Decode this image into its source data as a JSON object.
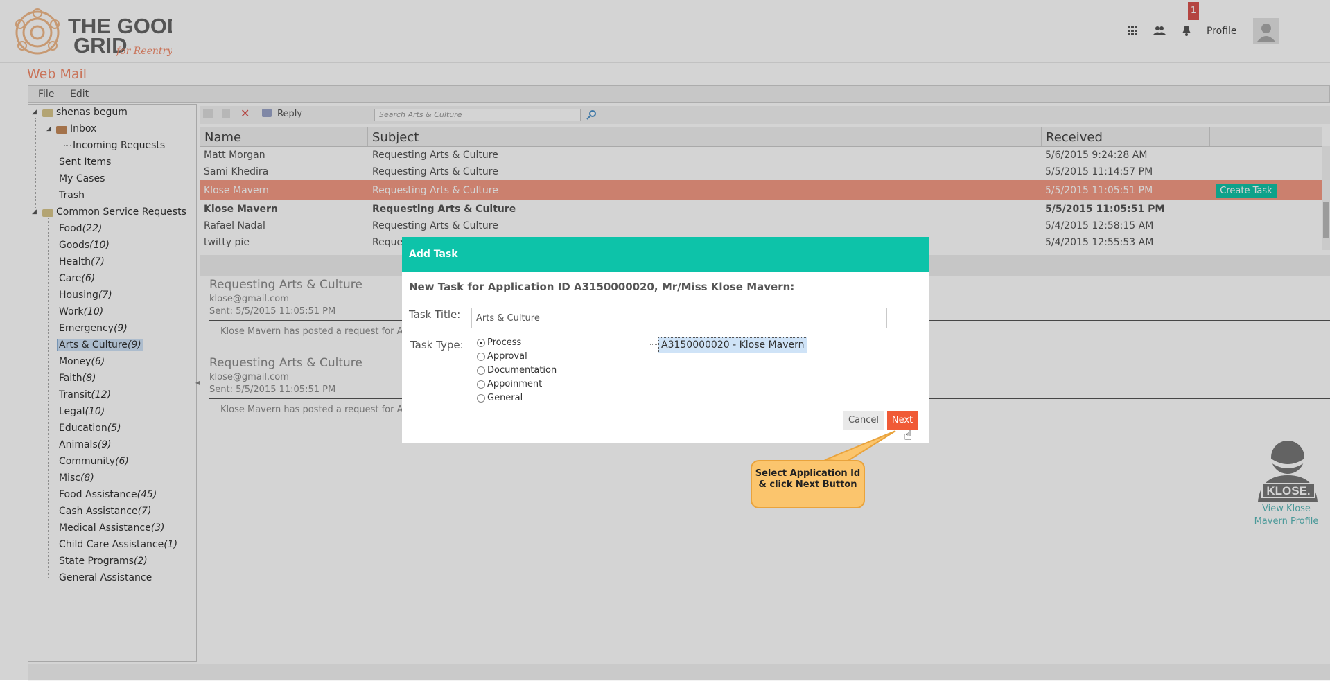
{
  "header": {
    "logo_top": "THE GOOD",
    "logo_bottom": "GRID",
    "logo_tagline": "for Reentry",
    "apps_icon": "apps-grid-icon",
    "people_icon": "people-icon",
    "bell_icon": "bell-icon",
    "notification_count": "1",
    "profile_label": "Profile"
  },
  "page_title": "Web Mail",
  "menu": [
    "File",
    "Edit"
  ],
  "tree": {
    "root": "shenas begum",
    "inbox": "Inbox",
    "incoming": "Incoming Requests",
    "sent": "Sent Items",
    "cases": "My Cases",
    "trash": "Trash",
    "common": "Common Service Requests",
    "categories": [
      {
        "name": "Food",
        "count": "(22)"
      },
      {
        "name": "Goods",
        "count": "(10)"
      },
      {
        "name": "Health",
        "count": "(7)"
      },
      {
        "name": "Care",
        "count": "(6)"
      },
      {
        "name": "Housing",
        "count": "(7)"
      },
      {
        "name": "Work",
        "count": "(10)"
      },
      {
        "name": "Emergency",
        "count": "(9)"
      },
      {
        "name": "Arts & Culture",
        "count": "(9)"
      },
      {
        "name": "Money",
        "count": "(6)"
      },
      {
        "name": "Faith",
        "count": "(8)"
      },
      {
        "name": "Transit",
        "count": "(12)"
      },
      {
        "name": "Legal",
        "count": "(10)"
      },
      {
        "name": "Education",
        "count": "(5)"
      },
      {
        "name": "Animals",
        "count": "(9)"
      },
      {
        "name": "Community",
        "count": "(6)"
      },
      {
        "name": "Misc",
        "count": "(8)"
      },
      {
        "name": "Food Assistance",
        "count": "(45)"
      },
      {
        "name": "Cash Assistance",
        "count": "(7)"
      },
      {
        "name": "Medical Assistance",
        "count": "(3)"
      },
      {
        "name": "Child Care Assistance",
        "count": "(1)"
      },
      {
        "name": "State Programs",
        "count": "(2)"
      },
      {
        "name": "General Assistance",
        "count": ""
      }
    ]
  },
  "toolbar": {
    "reply_label": "Reply",
    "search_placeholder": "Search Arts & Culture"
  },
  "grid": {
    "columns": [
      "Name",
      "Subject",
      "Received"
    ],
    "rows": [
      {
        "name": "Matt Morgan",
        "subject": "Requesting Arts & Culture",
        "received": "5/6/2015 9:24:28 AM"
      },
      {
        "name": "Sami Khedira",
        "subject": "Requesting Arts & Culture",
        "received": "5/5/2015 11:14:57 PM"
      },
      {
        "name": "Klose Mavern",
        "subject": "Requesting Arts & Culture",
        "received": "5/5/2015 11:05:51 PM"
      },
      {
        "name": "Klose Mavern",
        "subject": "Requesting Arts & Culture",
        "received": "5/5/2015 11:05:51 PM"
      },
      {
        "name": "Rafael Nadal",
        "subject": "Requesting Arts & Culture",
        "received": "5/4/2015 12:58:15 AM"
      },
      {
        "name": "twitty pie",
        "subject": "Reque",
        "received": "5/4/2015 12:55:53 AM"
      }
    ],
    "create_task_label": "Create Task"
  },
  "preview": [
    {
      "title": "Requesting Arts & Culture",
      "email": "klose@gmail.com",
      "sent": "Sent: 5/5/2015 11:05:51 PM",
      "body": "Klose Mavern has posted a request for Arts &"
    },
    {
      "title": "Requesting Arts & Culture",
      "email": "klose@gmail.com",
      "sent": "Sent: 5/5/2015 11:05:51 PM",
      "body": "Klose Mavern has posted a request for Arts &"
    }
  ],
  "modal": {
    "title": "Add Task",
    "heading": "New Task for Application ID A3150000020, Mr/Miss Klose Mavern:",
    "task_title_label": "Task Title:",
    "task_title_value": "Arts & Culture",
    "task_type_label": "Task Type:",
    "types": [
      "Process",
      "Approval",
      "Documentation",
      "Appoinment",
      "General"
    ],
    "selected_type": "Process",
    "application_item": "A3150000020 - Klose Mavern",
    "cancel_label": "Cancel",
    "next_label": "Next"
  },
  "callout": {
    "text": "Select Application Id & click Next Button"
  },
  "profile_card": {
    "badge_text": "KLOSE.",
    "link": "View Klose Mavern Profile"
  },
  "colors": {
    "accent_teal": "#0dc3a9",
    "selected_row": "#f49a85",
    "next_button": "#f05a36",
    "title_orange": "#f28b6b"
  }
}
